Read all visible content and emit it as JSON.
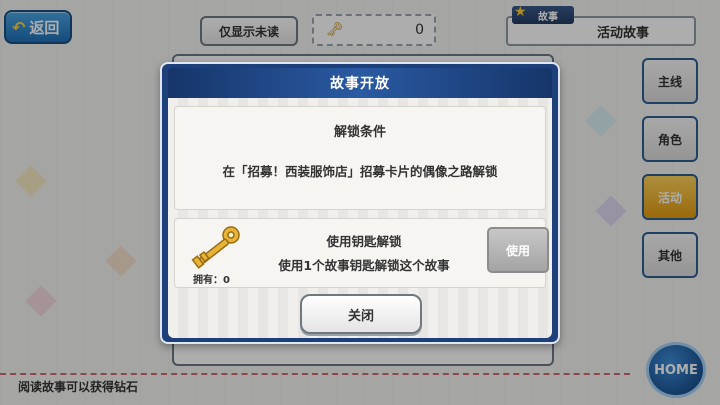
{
  "top_bar": {
    "back_label": "返回",
    "filter_label": "仅显示未读",
    "key_count": "0",
    "story_type_tag": "故事",
    "story_type_value": "活动故事"
  },
  "side_tabs": [
    {
      "label": "主线",
      "active": false
    },
    {
      "label": "角色",
      "active": false
    },
    {
      "label": "活动",
      "active": true
    },
    {
      "label": "其他",
      "active": false
    }
  ],
  "home_label": "HOME",
  "footer_text": "阅读故事可以获得钻石",
  "dialog": {
    "title": "故事开放",
    "condition_title": "解锁条件",
    "condition_text": "在「招募！西装服饰店」招募卡片的偶像之路解锁",
    "key_title": "使用钥匙解锁",
    "key_description": "使用1个故事钥匙解锁这个故事",
    "owned_label": "拥有：0",
    "use_button": "使用",
    "close_button": "关闭"
  },
  "colors": {
    "dialog_frame": "#1d3f7a",
    "active_tab": "#e39b10",
    "back_button": "#1f6fb5"
  }
}
